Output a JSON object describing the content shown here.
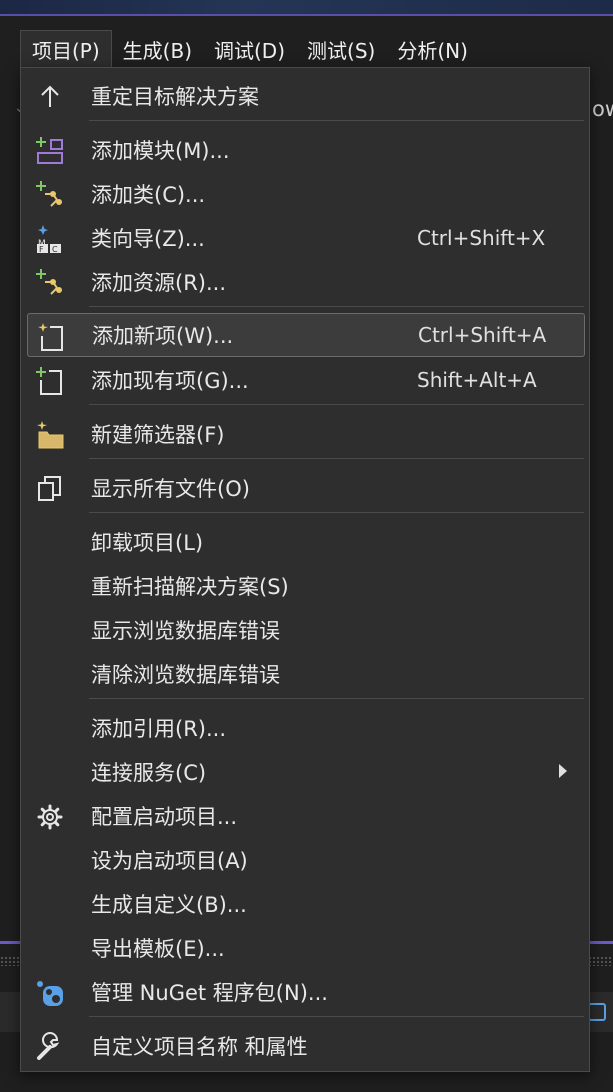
{
  "menubar": {
    "items": [
      {
        "label": "项目(P)",
        "active": true
      },
      {
        "label": "生成(B)",
        "active": false
      },
      {
        "label": "调试(D)",
        "active": false
      },
      {
        "label": "测试(S)",
        "active": false
      },
      {
        "label": "分析(N)",
        "active": false
      }
    ]
  },
  "background": {
    "right_text": "ow"
  },
  "menu": {
    "retarget": {
      "label": "重定目标解决方案",
      "icon": "arrow-up-icon"
    },
    "add_module": {
      "label": "添加模块(M)...",
      "icon": "add-module-icon"
    },
    "add_class": {
      "label": "添加类(C)...",
      "icon": "add-class-icon"
    },
    "class_wizard": {
      "label": "类向导(Z)...",
      "shortcut": "Ctrl+Shift+X",
      "icon": "class-wizard-icon"
    },
    "add_resource": {
      "label": "添加资源(R)...",
      "icon": "add-resource-icon"
    },
    "add_new_item": {
      "label": "添加新项(W)...",
      "shortcut": "Ctrl+Shift+A",
      "icon": "new-item-icon"
    },
    "add_existing_item": {
      "label": "添加现有项(G)...",
      "shortcut": "Shift+Alt+A",
      "icon": "existing-item-icon"
    },
    "new_filter": {
      "label": "新建筛选器(F)",
      "icon": "new-folder-icon"
    },
    "show_all_files": {
      "label": "显示所有文件(O)",
      "icon": "show-all-files-icon"
    },
    "unload_project": {
      "label": "卸载项目(L)"
    },
    "rescan_solution": {
      "label": "重新扫描解决方案(S)"
    },
    "show_browse_db_errors": {
      "label": "显示浏览数据库错误"
    },
    "clear_browse_db_errors": {
      "label": "清除浏览数据库错误"
    },
    "add_reference": {
      "label": "添加引用(R)..."
    },
    "connected_services": {
      "label": "连接服务(C)"
    },
    "configure_startup": {
      "label": "配置启动项目...",
      "icon": "gear-icon"
    },
    "set_startup": {
      "label": "设为启动项目(A)"
    },
    "build_customizations": {
      "label": "生成自定义(B)..."
    },
    "export_template": {
      "label": "导出模板(E)..."
    },
    "manage_nuget": {
      "label": "管理 NuGet 程序包(N)...",
      "icon": "nuget-icon"
    },
    "customize_project": {
      "label": "自定义项目名称 和属性",
      "icon": "wrench-icon"
    }
  },
  "colors": {
    "menu_bg": "#2e2e2e",
    "highlight_bg": "#3c3c3c",
    "accent_purple": "#6a5acd",
    "icon_green": "#7ec86a",
    "icon_yellow": "#e8c86a",
    "icon_purple": "#a07ad8",
    "icon_blue": "#5aa0e6"
  }
}
